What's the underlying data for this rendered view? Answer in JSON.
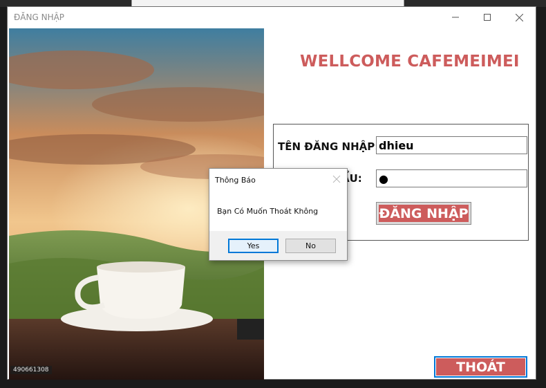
{
  "window": {
    "title": "ĐĂNG NHẬP",
    "controls": [
      "minimize-icon",
      "maximize-icon",
      "close-icon"
    ]
  },
  "photo": {
    "stamp": "490661308"
  },
  "welcome_text": "WELLCOME CAFEMEIMEI",
  "login": {
    "username_label": "TÊN ĐĂNG NHẬP:",
    "username_value": "dhieu",
    "password_label_visible": "ẨU:",
    "password_value": "●",
    "login_button": "ĐĂNG NHẬP"
  },
  "exit_button": "THOÁT",
  "dialog": {
    "title": "Thông Báo",
    "message": "Bạn Có Muốn Thoát Không",
    "yes": "Yes",
    "no": "No"
  },
  "colors": {
    "accent": "#cd5c5c",
    "focus": "#0078d7"
  }
}
